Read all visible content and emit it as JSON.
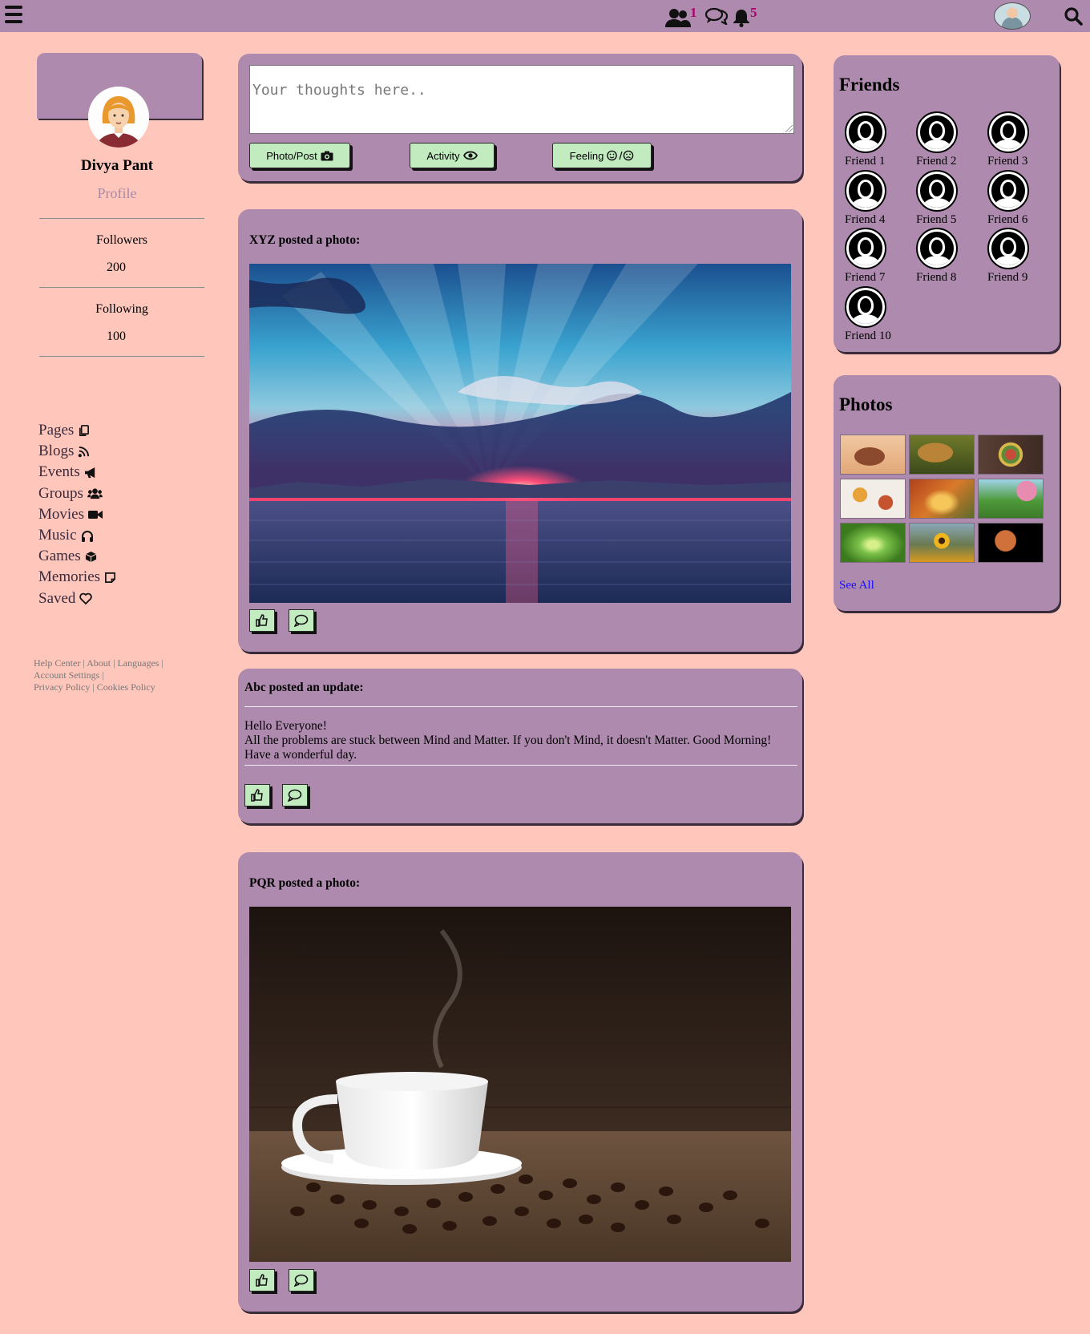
{
  "topbar": {
    "friend_requests_count": "1",
    "notifications_count": "5",
    "icons": [
      "menu-icon",
      "friends-icon",
      "chat-icon",
      "bell-icon",
      "avatar",
      "search-icon"
    ]
  },
  "profile": {
    "name": "Divya Pant",
    "link_label": "Profile",
    "followers_label": "Followers",
    "followers_value": "200",
    "following_label": "Following",
    "following_value": "100"
  },
  "nav": {
    "items": [
      {
        "label": "Pages",
        "icon": "copy-icon"
      },
      {
        "label": "Blogs",
        "icon": "feed-icon"
      },
      {
        "label": "Events",
        "icon": "megaphone-icon"
      },
      {
        "label": "Groups",
        "icon": "group-icon"
      },
      {
        "label": "Movies",
        "icon": "video-camera-icon"
      },
      {
        "label": "Music",
        "icon": "headphones-icon"
      },
      {
        "label": "Games",
        "icon": "cube-icon"
      },
      {
        "label": "Memories",
        "icon": "sticky-note-icon"
      },
      {
        "label": "Saved",
        "icon": "heart-icon"
      }
    ]
  },
  "footer": {
    "help": "Help Center",
    "about": "About",
    "languages": "Languages",
    "account": "Account Settings",
    "privacy": "Privacy Policy",
    "cookies": "Cookies Policy"
  },
  "composer": {
    "placeholder": "Your thoughts here..",
    "photo_label": "Photo/Post",
    "activity_label": "Activity",
    "feeling_label": "Feeling"
  },
  "posts": [
    {
      "title": "XYZ posted a photo:",
      "image": "sunset over sea"
    },
    {
      "title": "Abc posted an update:",
      "lines": [
        "Hello Everyone!",
        "All the problems are stuck between Mind and Matter. If you don't Mind, it doesn't Matter. Good Morning!",
        "Have a wonderful day."
      ]
    },
    {
      "title": "PQR posted a photo:",
      "image": "coffee cup with beans"
    }
  ],
  "friends": {
    "heading": "Friends",
    "names": [
      "Friend 1",
      "Friend 2",
      "Friend 3",
      "Friend 4",
      "Friend 5",
      "Friend 6",
      "Friend 7",
      "Friend 8",
      "Friend 9",
      "Friend 10"
    ]
  },
  "photos": {
    "heading": "Photos",
    "see_all": "See All",
    "thumbs": [
      "elephants",
      "lion",
      "fruit bowl",
      "food dishes",
      "autumn forest",
      "spring park",
      "green tunnel",
      "sunflowers",
      "planet"
    ]
  },
  "colors": {
    "background": "#ffc6bb",
    "panel": "#ad8aae",
    "button": "#c2ebc0",
    "badge": "#b0006a",
    "link": "#1a0dff"
  }
}
